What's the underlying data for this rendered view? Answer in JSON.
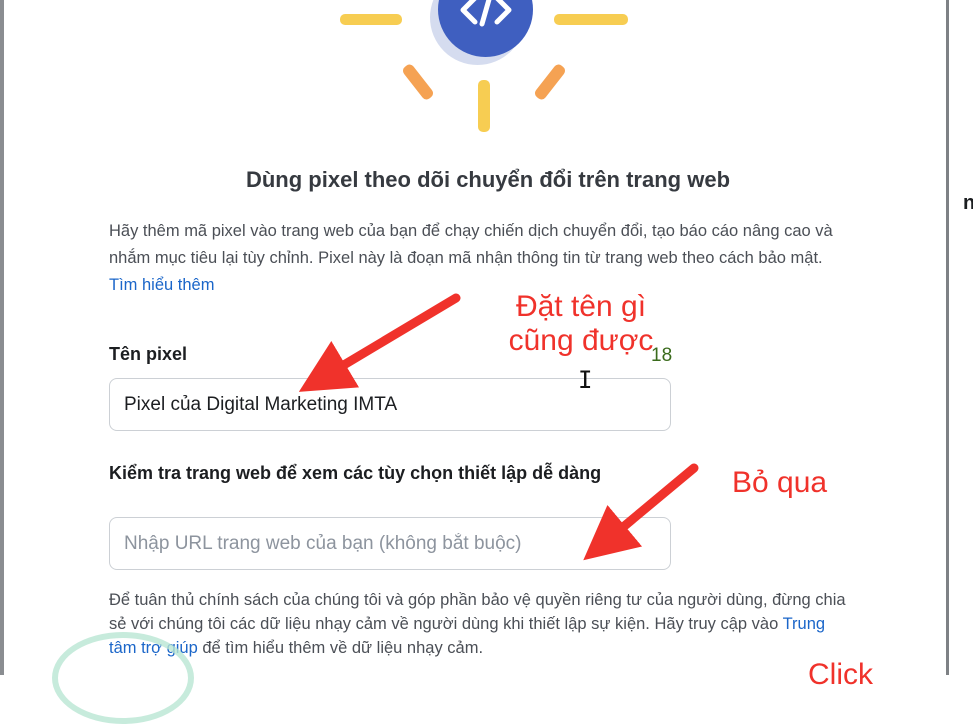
{
  "dialog": {
    "title": "Dùng pixel theo dõi chuyển đổi trên trang web",
    "description": "Hãy thêm mã pixel vào trang web của bạn để chạy chiến dịch chuyển đổi, tạo báo cáo nâng cao và nhắm mục tiêu lại tùy chỉnh. Pixel này là đoạn mã nhận thông tin từ trang web theo cách bảo mật.",
    "learn_more": "Tìm hiểu thêm",
    "pixel_name": {
      "label": "Tên pixel",
      "value": "Pixel của Digital Marketing IMTA",
      "counter": "18"
    },
    "website_check": {
      "label": "Kiểm tra trang web để xem các tùy chọn thiết lập dễ dàng",
      "placeholder": "Nhập URL trang web của bạn (không bắt buộc)"
    },
    "privacy_note": {
      "before": "Để tuân thủ chính sách của chúng tôi và góp phần bảo vệ quyền riêng tư của người dùng, đừng chia sẻ với chúng tôi các dữ liệu nhạy cảm về người dùng khi thiết lập sự kiện. Hãy truy cập vào ",
      "link": "Trung tâm trợ giúp",
      "after": " để tìm hiểu thêm về dữ liệu nhạy cảm."
    },
    "hero_icon": "code-brackets-icon"
  },
  "annotations": {
    "name_hint_line1": "Đặt tên gì",
    "name_hint_line2": "cũng được",
    "skip_hint": "Bỏ qua",
    "click_hint": "Click"
  },
  "background": {
    "peek_text": "n"
  },
  "colors": {
    "accent_blue": "#3f5fc0",
    "link": "#1b66c9",
    "ray_yellow": "#f7cd52",
    "ray_orange": "#f5a253",
    "annotation_red": "#f0322b"
  }
}
